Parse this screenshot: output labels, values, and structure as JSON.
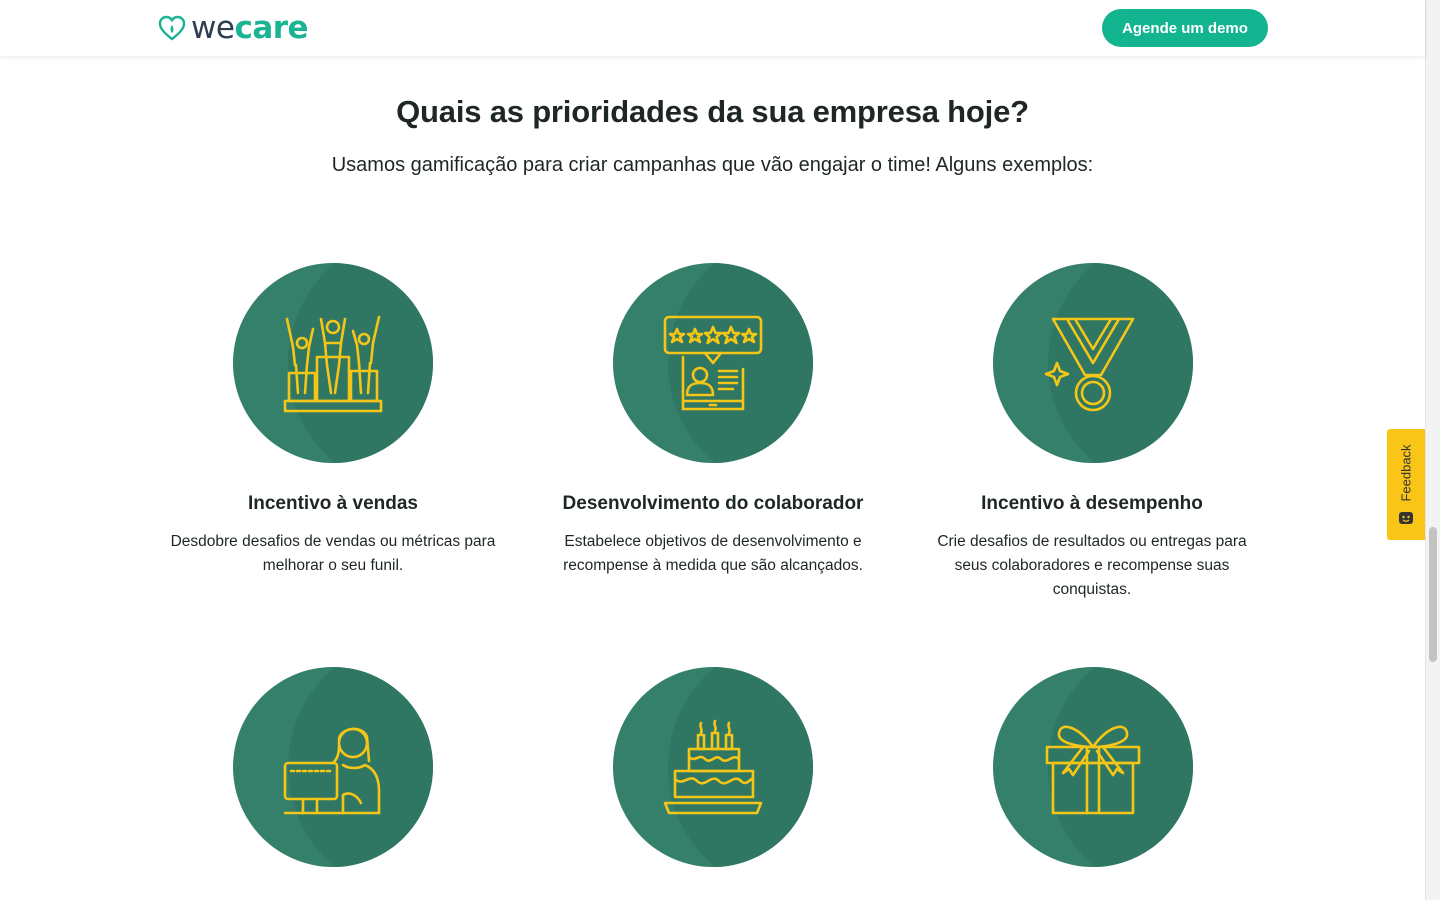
{
  "header": {
    "logo_we": "we",
    "logo_care": "care",
    "demo_button": "Agende um demo"
  },
  "section": {
    "title": "Quais as prioridades da sua empresa hoje?",
    "subtitle": "Usamos gamificação para criar campanhas que vão engajar o time! Alguns exemplos:"
  },
  "cards": [
    {
      "icon": "podium-winners-icon",
      "title": "Incentivo à vendas",
      "desc": "Desdobre desafios de vendas ou métricas para melhorar o seu funil."
    },
    {
      "icon": "rating-review-icon",
      "title": "Desenvolvimento do colaborador",
      "desc": "Estabelece objetivos de desenvolvimento e recompense à medida que são alcançados."
    },
    {
      "icon": "medal-icon",
      "title": "Incentivo à desempenho",
      "desc": "Crie desafios de resultados ou entregas para seus colaboradores e recompense suas conquistas."
    },
    {
      "icon": "remote-worker-icon",
      "title": "",
      "desc": ""
    },
    {
      "icon": "birthday-cake-icon",
      "title": "",
      "desc": ""
    },
    {
      "icon": "gift-box-icon",
      "title": "",
      "desc": ""
    }
  ],
  "feedback": {
    "label": "Feedback"
  },
  "colors": {
    "brand_green": "#13b490",
    "circle_green": "#35806a",
    "icon_yellow": "#f5c518",
    "feedback_yellow": "#f9c617"
  }
}
